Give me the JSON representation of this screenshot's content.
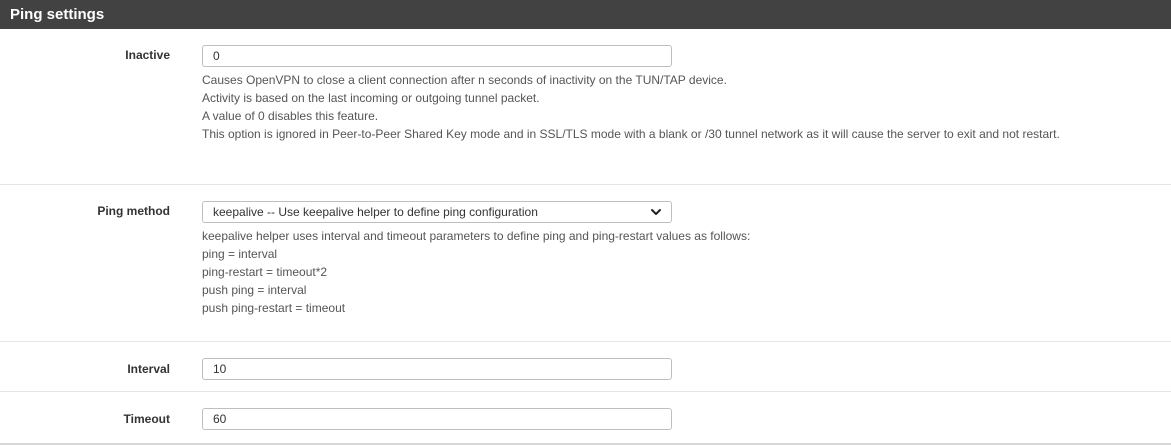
{
  "panel": {
    "title": "Ping settings"
  },
  "inactive": {
    "label": "Inactive",
    "value": "0",
    "help": [
      "Causes OpenVPN to close a client connection after n seconds of inactivity on the TUN/TAP device.",
      "Activity is based on the last incoming or outgoing tunnel packet.",
      "A value of 0 disables this feature.",
      "This option is ignored in Peer-to-Peer Shared Key mode and in SSL/TLS mode with a blank or /30 tunnel network as it will cause the server to exit and not restart."
    ]
  },
  "ping_method": {
    "label": "Ping method",
    "selected": "keepalive -- Use keepalive helper to define ping configuration",
    "help": [
      "keepalive helper uses interval and timeout parameters to define ping and ping-restart values as follows:",
      "ping = interval",
      "ping-restart = timeout*2",
      "push ping = interval",
      "push ping-restart = timeout"
    ]
  },
  "interval": {
    "label": "Interval",
    "value": "10"
  },
  "timeout": {
    "label": "Timeout",
    "value": "60"
  },
  "icons": {
    "select_chevron": "chevron-down-icon"
  },
  "colors": {
    "heading_bg": "#424242",
    "heading_text": "#ffffff"
  }
}
